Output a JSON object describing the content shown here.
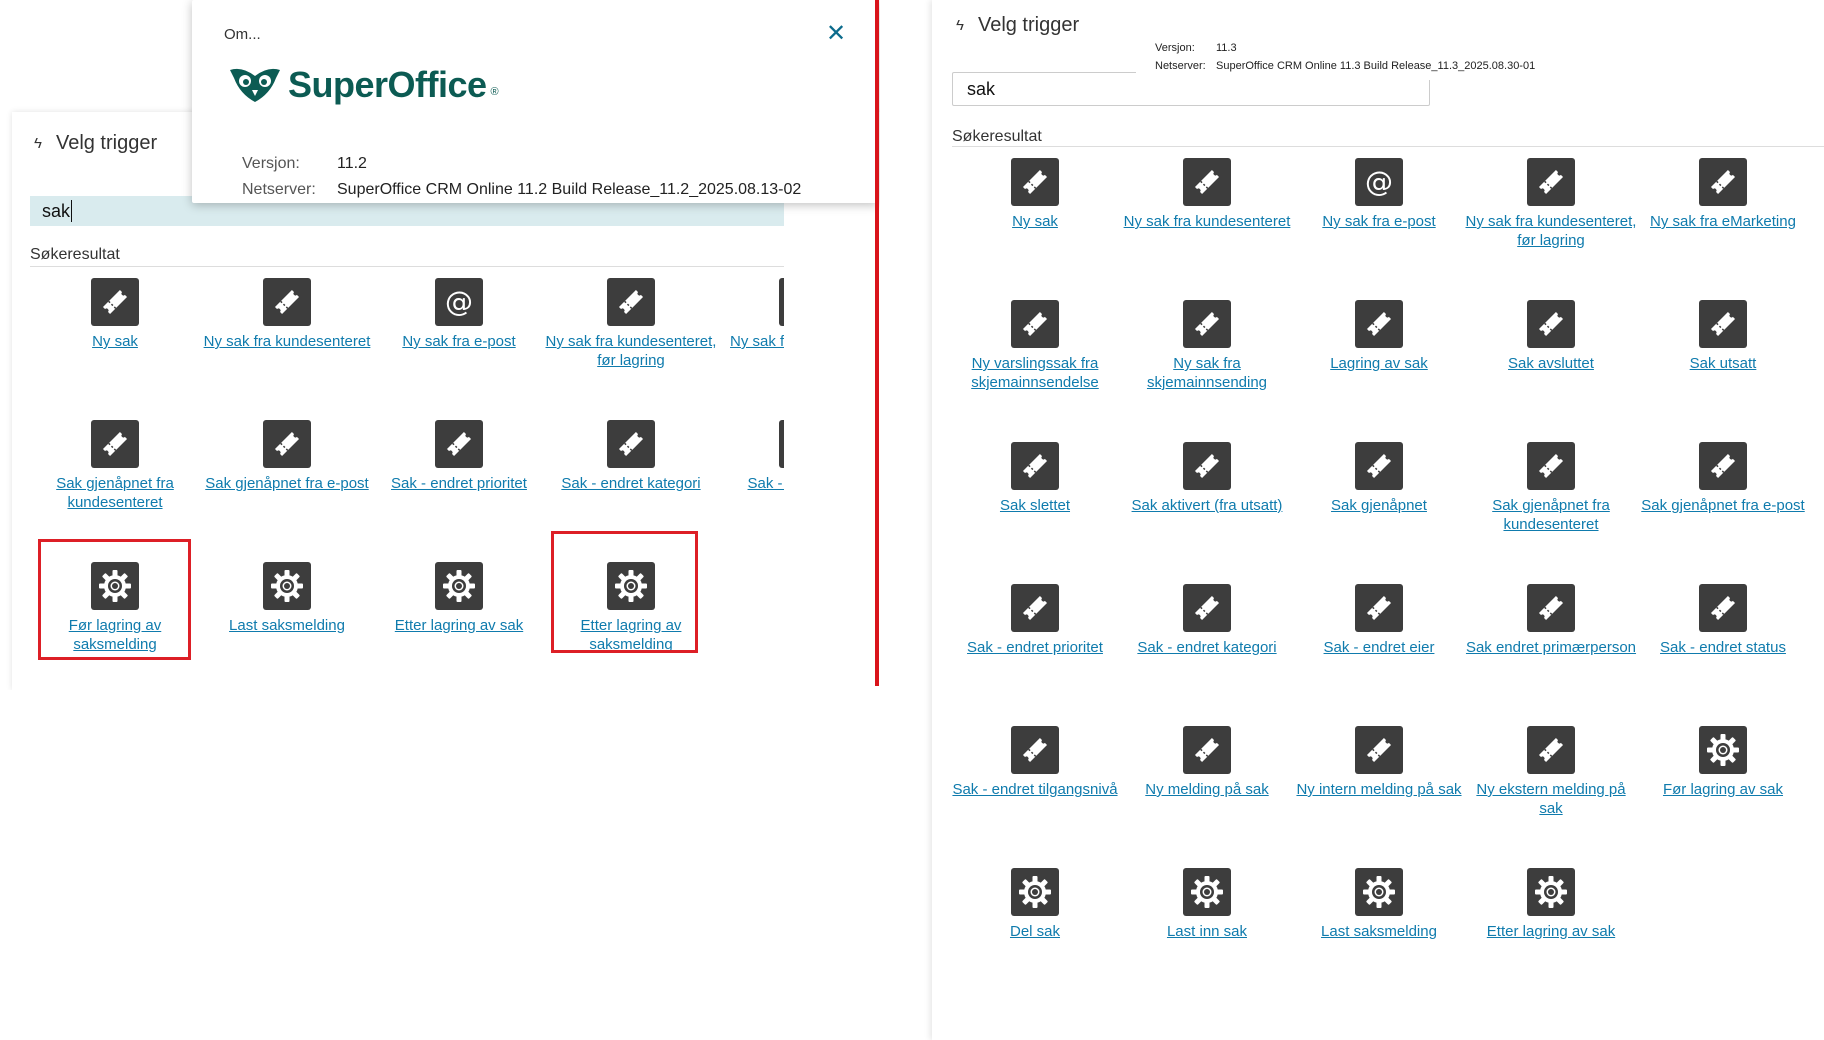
{
  "left": {
    "title": "Velg trigger",
    "search_value": "sak",
    "results_label": "Søkeresultat",
    "modal": {
      "title": "Om...",
      "close_icon": "close-icon",
      "logo_text": "SuperOffice",
      "logo_reg": "®",
      "version_key": "Versjon:",
      "version_value": "11.2",
      "netserver_key": "Netserver:",
      "netserver_value": "SuperOffice CRM Online 11.2 Build Release_11.2_2025.08.13-02"
    },
    "tiles": [
      {
        "label": "Ny sak",
        "icon": "ticket-icon"
      },
      {
        "label": "Ny sak fra kundesenteret",
        "icon": "ticket-icon"
      },
      {
        "label": "Ny sak fra e-post",
        "icon": "at-icon"
      },
      {
        "label": "Ny sak fra kundesenteret, før lagring",
        "icon": "ticket-icon"
      },
      {
        "label": "Ny sak fra eMarketing",
        "icon": "ticket-icon"
      },
      {
        "label": "Sak gjenåpnet fra kundesenteret",
        "icon": "ticket-icon"
      },
      {
        "label": "Sak gjenåpnet fra e-post",
        "icon": "ticket-icon"
      },
      {
        "label": "Sak - endret prioritet",
        "icon": "ticket-icon"
      },
      {
        "label": "Sak - endret kategori",
        "icon": "ticket-icon"
      },
      {
        "label": "Sak - endret eier",
        "icon": "ticket-icon"
      },
      {
        "label": "Før lagring av saksmelding",
        "icon": "gear-icon"
      },
      {
        "label": "Last saksmelding",
        "icon": "gear-icon"
      },
      {
        "label": "Etter lagring av sak",
        "icon": "gear-icon"
      },
      {
        "label": "Etter lagring av saksmelding",
        "icon": "gear-icon"
      }
    ],
    "clipped_labels": [
      "Ny sak fra eMarketing",
      "Sak - endret eier"
    ]
  },
  "right": {
    "title": "Velg trigger",
    "search_value": "sak",
    "results_label": "Søkeresultat",
    "version_key": "Versjon:",
    "version_value": "11.3",
    "netserver_key": "Netserver:",
    "netserver_value": "SuperOffice CRM Online 11.3 Build Release_11.3_2025.08.30-01",
    "tiles": [
      {
        "label": "Ny sak",
        "icon": "ticket-icon"
      },
      {
        "label": "Ny sak fra kundesenteret",
        "icon": "ticket-icon"
      },
      {
        "label": "Ny sak fra e-post",
        "icon": "at-icon"
      },
      {
        "label": "Ny sak fra kundesenteret, før lagring",
        "icon": "ticket-icon"
      },
      {
        "label": "Ny sak fra eMarketing",
        "icon": "ticket-icon"
      },
      {
        "label": "Ny varslingssak fra skjemainnsendelse",
        "icon": "ticket-icon"
      },
      {
        "label": "Ny sak fra skjemainnsending",
        "icon": "ticket-icon"
      },
      {
        "label": "Lagring av sak",
        "icon": "ticket-icon"
      },
      {
        "label": "Sak avsluttet",
        "icon": "ticket-icon"
      },
      {
        "label": "Sak utsatt",
        "icon": "ticket-icon"
      },
      {
        "label": "Sak slettet",
        "icon": "ticket-icon"
      },
      {
        "label": "Sak aktivert (fra utsatt)",
        "icon": "ticket-icon"
      },
      {
        "label": "Sak gjenåpnet",
        "icon": "ticket-icon"
      },
      {
        "label": "Sak gjenåpnet fra kundesenteret",
        "icon": "ticket-icon"
      },
      {
        "label": "Sak gjenåpnet fra e-post",
        "icon": "ticket-icon"
      },
      {
        "label": "Sak - endret prioritet",
        "icon": "ticket-icon"
      },
      {
        "label": "Sak - endret kategori",
        "icon": "ticket-icon"
      },
      {
        "label": "Sak - endret eier",
        "icon": "ticket-icon"
      },
      {
        "label": "Sak endret primærperson",
        "icon": "ticket-icon"
      },
      {
        "label": "Sak - endret status",
        "icon": "ticket-icon"
      },
      {
        "label": "Sak - endret tilgangsnivå",
        "icon": "ticket-icon"
      },
      {
        "label": "Ny melding på sak",
        "icon": "ticket-icon"
      },
      {
        "label": "Ny intern melding på sak",
        "icon": "ticket-icon"
      },
      {
        "label": "Ny ekstern melding på sak",
        "icon": "ticket-icon"
      },
      {
        "label": "Før lagring av sak",
        "icon": "gear-icon"
      },
      {
        "label": "Del sak",
        "icon": "gear-icon"
      },
      {
        "label": "Last inn sak",
        "icon": "gear-icon"
      },
      {
        "label": "Last saksmelding",
        "icon": "gear-icon"
      },
      {
        "label": "Etter lagring av sak",
        "icon": "gear-icon"
      }
    ]
  },
  "colors": {
    "link": "#0f7bad",
    "icon_bg": "#3d3d3d",
    "highlight": "#dd1f26",
    "divider": "#d9141b",
    "brand": "#0c5b53",
    "search_bg": "#d9ebee"
  }
}
